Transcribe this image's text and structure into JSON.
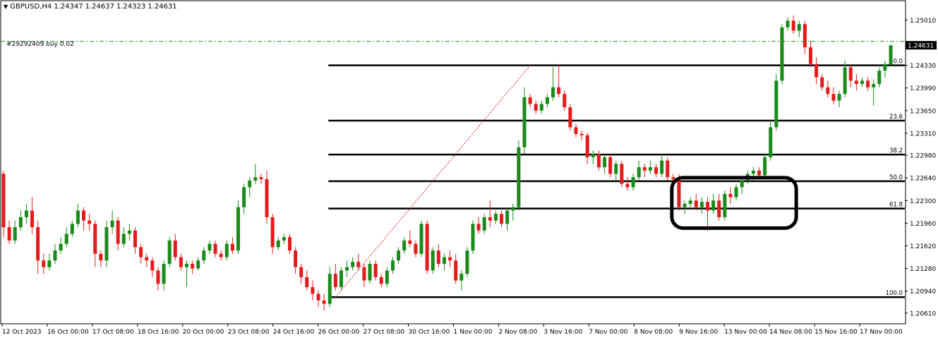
{
  "header": {
    "symbol": "GBPUSD,H4",
    "open": "1.24347",
    "high": "1.24637",
    "low": "1.24323",
    "close": "1.24631"
  },
  "order_label": "#29292409 buy 0.02",
  "current_price": "1.24631",
  "colors": {
    "bull": "#1a8a1a",
    "bear": "#e51b1b",
    "fib": "#000000",
    "order_line": "#2a8a2a",
    "trend": "#e51b1b"
  },
  "chart_data": {
    "type": "candlestick",
    "title": "GBPUSD,H4",
    "ylim": [
      1.2045,
      1.253
    ],
    "y_ticks": [
      "1.25010",
      "1.24330",
      "1.23990",
      "1.23650",
      "1.23310",
      "1.22980",
      "1.22640",
      "1.22300",
      "1.21960",
      "1.21620",
      "1.21280",
      "1.20940",
      "1.20610"
    ],
    "x_ticks": [
      "12 Oct 2023",
      "16 Oct 00:00",
      "17 Oct 08:00",
      "18 Oct 16:00",
      "20 Oct 00:00",
      "23 Oct 08:00",
      "24 Oct 16:00",
      "26 Oct 00:00",
      "27 Oct 08:00",
      "30 Oct 16:00",
      "1 Nov 00:00",
      "2 Nov 08:00",
      "3 Nov 16:00",
      "7 Nov 00:00",
      "8 Nov 08:00",
      "9 Nov 16:00",
      "13 Nov 00:00",
      "14 Nov 08:00",
      "15 Nov 16:00",
      "17 Nov 00:00"
    ],
    "fibonacci": [
      {
        "label": "0.0",
        "price": 1.2433
      },
      {
        "label": "23.6",
        "price": 1.235
      },
      {
        "label": "38.2",
        "price": 1.2299
      },
      {
        "label": "50.0",
        "price": 1.2259
      },
      {
        "label": "61.8",
        "price": 1.2218
      },
      {
        "label": "100.0",
        "price": 1.2085
      }
    ],
    "fib_anchor_bar": 57,
    "trend_line": {
      "from_bar": 58,
      "from_price": 1.2085,
      "to_bar": 92,
      "to_price": 1.2433
    },
    "order_price": 1.2469,
    "highlight_zone": {
      "from_bar": 117,
      "to_bar": 138,
      "low": 1.2195,
      "high": 1.2258
    },
    "candles": [
      [
        1.227,
        1.2275,
        1.2175,
        1.219
      ],
      [
        1.219,
        1.22,
        1.2165,
        1.217
      ],
      [
        1.217,
        1.22,
        1.2165,
        1.219
      ],
      [
        1.219,
        1.2215,
        1.2185,
        1.2205
      ],
      [
        1.2205,
        1.2225,
        1.2195,
        1.2215
      ],
      [
        1.2215,
        1.2235,
        1.218,
        1.219
      ],
      [
        1.219,
        1.22,
        1.212,
        1.214
      ],
      [
        1.214,
        1.215,
        1.212,
        1.213
      ],
      [
        1.213,
        1.215,
        1.2125,
        1.214
      ],
      [
        1.214,
        1.2165,
        1.2135,
        1.2155
      ],
      [
        1.2155,
        1.2175,
        1.215,
        1.2165
      ],
      [
        1.2165,
        1.219,
        1.216,
        1.218
      ],
      [
        1.218,
        1.22,
        1.2175,
        1.2195
      ],
      [
        1.2195,
        1.2225,
        1.219,
        1.2215
      ],
      [
        1.2215,
        1.222,
        1.2185,
        1.22
      ],
      [
        1.22,
        1.221,
        1.2185,
        1.2195
      ],
      [
        1.2195,
        1.22,
        1.213,
        1.215
      ],
      [
        1.215,
        1.2155,
        1.213,
        1.214
      ],
      [
        1.214,
        1.22,
        1.213,
        1.219
      ],
      [
        1.219,
        1.2215,
        1.218,
        1.22
      ],
      [
        1.22,
        1.2205,
        1.2155,
        1.2165
      ],
      [
        1.2165,
        1.219,
        1.216,
        1.218
      ],
      [
        1.218,
        1.2195,
        1.217,
        1.2185
      ],
      [
        1.2185,
        1.219,
        1.215,
        1.216
      ],
      [
        1.216,
        1.2165,
        1.2135,
        1.2145
      ],
      [
        1.2145,
        1.215,
        1.213,
        1.214
      ],
      [
        1.214,
        1.2145,
        1.2115,
        1.2125
      ],
      [
        1.2125,
        1.213,
        1.2095,
        1.2105
      ],
      [
        1.2105,
        1.214,
        1.2095,
        1.2135
      ],
      [
        1.2135,
        1.2175,
        1.213,
        1.217
      ],
      [
        1.217,
        1.218,
        1.214,
        1.2145
      ],
      [
        1.2145,
        1.215,
        1.2125,
        1.213
      ],
      [
        1.213,
        1.214,
        1.21,
        1.2135
      ],
      [
        1.2135,
        1.214,
        1.212,
        1.2128
      ],
      [
        1.2128,
        1.2145,
        1.2125,
        1.214
      ],
      [
        1.214,
        1.216,
        1.2135,
        1.2155
      ],
      [
        1.2155,
        1.217,
        1.215,
        1.2165
      ],
      [
        1.2165,
        1.217,
        1.2145,
        1.215
      ],
      [
        1.215,
        1.2155,
        1.214,
        1.2145
      ],
      [
        1.2145,
        1.217,
        1.214,
        1.2165
      ],
      [
        1.2165,
        1.2175,
        1.215,
        1.2155
      ],
      [
        1.2155,
        1.223,
        1.215,
        1.222
      ],
      [
        1.222,
        1.2255,
        1.221,
        1.225
      ],
      [
        1.225,
        1.2265,
        1.2235,
        1.226
      ],
      [
        1.226,
        1.2285,
        1.2255,
        1.2265
      ],
      [
        1.2265,
        1.227,
        1.2255,
        1.2262
      ],
      [
        1.2262,
        1.2275,
        1.2195,
        1.2205
      ],
      [
        1.2205,
        1.221,
        1.215,
        1.216
      ],
      [
        1.216,
        1.2175,
        1.2155,
        1.217
      ],
      [
        1.217,
        1.218,
        1.2165,
        1.2175
      ],
      [
        1.2175,
        1.218,
        1.215,
        1.2155
      ],
      [
        1.2155,
        1.216,
        1.212,
        1.213
      ],
      [
        1.213,
        1.2135,
        1.2105,
        1.2115
      ],
      [
        1.2115,
        1.2125,
        1.2095,
        1.21
      ],
      [
        1.21,
        1.211,
        1.208,
        1.209
      ],
      [
        1.209,
        1.2095,
        1.207,
        1.208
      ],
      [
        1.208,
        1.209,
        1.2065,
        1.2075
      ],
      [
        1.2075,
        1.213,
        1.207,
        1.212
      ],
      [
        1.212,
        1.2135,
        1.2095,
        1.21
      ],
      [
        1.21,
        1.213,
        1.2095,
        1.2125
      ],
      [
        1.2125,
        1.214,
        1.2115,
        1.213
      ],
      [
        1.213,
        1.2145,
        1.2125,
        1.2138
      ],
      [
        1.2138,
        1.215,
        1.2125,
        1.213
      ],
      [
        1.213,
        1.2135,
        1.21,
        1.211
      ],
      [
        1.211,
        1.214,
        1.2105,
        1.2135
      ],
      [
        1.2135,
        1.214,
        1.211,
        1.2115
      ],
      [
        1.2115,
        1.212,
        1.21,
        1.2105
      ],
      [
        1.2105,
        1.213,
        1.21,
        1.2125
      ],
      [
        1.2125,
        1.2145,
        1.212,
        1.214
      ],
      [
        1.214,
        1.216,
        1.2135,
        1.2155
      ],
      [
        1.2155,
        1.2175,
        1.215,
        1.217
      ],
      [
        1.217,
        1.2185,
        1.216,
        1.2165
      ],
      [
        1.2165,
        1.217,
        1.2145,
        1.215
      ],
      [
        1.215,
        1.22,
        1.2145,
        1.2195
      ],
      [
        1.2195,
        1.22,
        1.212,
        1.2125
      ],
      [
        1.2125,
        1.216,
        1.212,
        1.2155
      ],
      [
        1.2155,
        1.2165,
        1.213,
        1.2135
      ],
      [
        1.2135,
        1.215,
        1.2125,
        1.2145
      ],
      [
        1.2145,
        1.2155,
        1.213,
        1.214
      ],
      [
        1.214,
        1.215,
        1.2105,
        1.211
      ],
      [
        1.211,
        1.2125,
        1.2095,
        1.212
      ],
      [
        1.212,
        1.216,
        1.2115,
        1.2155
      ],
      [
        1.2155,
        1.22,
        1.215,
        1.2195
      ],
      [
        1.2195,
        1.2205,
        1.218,
        1.2185
      ],
      [
        1.2185,
        1.221,
        1.218,
        1.2205
      ],
      [
        1.2205,
        1.223,
        1.219,
        1.22
      ],
      [
        1.22,
        1.2215,
        1.2195,
        1.221
      ],
      [
        1.221,
        1.2215,
        1.219,
        1.2195
      ],
      [
        1.2195,
        1.222,
        1.2185,
        1.2215
      ],
      [
        1.2215,
        1.2225,
        1.22,
        1.222
      ],
      [
        1.222,
        1.232,
        1.2215,
        1.231
      ],
      [
        1.231,
        1.24,
        1.23,
        1.2385
      ],
      [
        1.2385,
        1.239,
        1.237,
        1.2375
      ],
      [
        1.2375,
        1.238,
        1.236,
        1.2365
      ],
      [
        1.2365,
        1.238,
        1.236,
        1.2375
      ],
      [
        1.2375,
        1.239,
        1.237,
        1.2385
      ],
      [
        1.2385,
        1.243,
        1.238,
        1.24
      ],
      [
        1.24,
        1.2435,
        1.2385,
        1.239
      ],
      [
        1.239,
        1.2395,
        1.2365,
        1.237
      ],
      [
        1.237,
        1.2375,
        1.2335,
        1.234
      ],
      [
        1.234,
        1.2345,
        1.2325,
        1.233
      ],
      [
        1.233,
        1.2335,
        1.232,
        1.2328
      ],
      [
        1.2328,
        1.2332,
        1.2285,
        1.2295
      ],
      [
        1.2295,
        1.2305,
        1.2285,
        1.23
      ],
      [
        1.23,
        1.2305,
        1.2275,
        1.228
      ],
      [
        1.228,
        1.23,
        1.227,
        1.2295
      ],
      [
        1.2295,
        1.23,
        1.2265,
        1.227
      ],
      [
        1.227,
        1.229,
        1.226,
        1.2285
      ],
      [
        1.2285,
        1.229,
        1.225,
        1.2255
      ],
      [
        1.2255,
        1.2265,
        1.2245,
        1.225
      ],
      [
        1.225,
        1.227,
        1.2245,
        1.2265
      ],
      [
        1.2265,
        1.229,
        1.226,
        1.228
      ],
      [
        1.228,
        1.2285,
        1.2265,
        1.2275
      ],
      [
        1.2275,
        1.229,
        1.227,
        1.228
      ],
      [
        1.228,
        1.2285,
        1.2265,
        1.227
      ],
      [
        1.227,
        1.23,
        1.2265,
        1.229
      ],
      [
        1.229,
        1.2295,
        1.226,
        1.2265
      ],
      [
        1.2265,
        1.227,
        1.2255,
        1.2262
      ],
      [
        1.2262,
        1.227,
        1.2215,
        1.222
      ],
      [
        1.222,
        1.223,
        1.221,
        1.2225
      ],
      [
        1.2225,
        1.2235,
        1.222,
        1.223
      ],
      [
        1.223,
        1.224,
        1.2215,
        1.222
      ],
      [
        1.222,
        1.2235,
        1.221,
        1.2228
      ],
      [
        1.2228,
        1.2235,
        1.2185,
        1.2215
      ],
      [
        1.2215,
        1.224,
        1.221,
        1.223
      ],
      [
        1.223,
        1.224,
        1.22,
        1.2205
      ],
      [
        1.2205,
        1.2245,
        1.22,
        1.224
      ],
      [
        1.224,
        1.225,
        1.2225,
        1.2235
      ],
      [
        1.2235,
        1.2255,
        1.223,
        1.225
      ],
      [
        1.225,
        1.2265,
        1.224,
        1.226
      ],
      [
        1.226,
        1.2275,
        1.2255,
        1.227
      ],
      [
        1.227,
        1.228,
        1.226,
        1.2275
      ],
      [
        1.2275,
        1.228,
        1.2262,
        1.2268
      ],
      [
        1.2268,
        1.23,
        1.2265,
        1.2295
      ],
      [
        1.2295,
        1.235,
        1.229,
        1.234
      ],
      [
        1.234,
        1.242,
        1.2335,
        1.241
      ],
      [
        1.241,
        1.2495,
        1.2405,
        1.249
      ],
      [
        1.249,
        1.2505,
        1.2485,
        1.25
      ],
      [
        1.25,
        1.2508,
        1.248,
        1.2485
      ],
      [
        1.2485,
        1.25,
        1.2475,
        1.2495
      ],
      [
        1.2495,
        1.25,
        1.245,
        1.246
      ],
      [
        1.246,
        1.247,
        1.243,
        1.2435
      ],
      [
        1.2435,
        1.2445,
        1.2405,
        1.2415
      ],
      [
        1.2415,
        1.242,
        1.2395,
        1.24
      ],
      [
        1.24,
        1.241,
        1.2385,
        1.239
      ],
      [
        1.239,
        1.24,
        1.2375,
        1.238
      ],
      [
        1.238,
        1.2395,
        1.237,
        1.239
      ],
      [
        1.239,
        1.244,
        1.2385,
        1.243
      ],
      [
        1.243,
        1.2435,
        1.24,
        1.241
      ],
      [
        1.241,
        1.242,
        1.2395,
        1.2405
      ],
      [
        1.2405,
        1.2415,
        1.24,
        1.241
      ],
      [
        1.241,
        1.2415,
        1.2395,
        1.24
      ],
      [
        1.24,
        1.2412,
        1.2372,
        1.2405
      ],
      [
        1.2405,
        1.243,
        1.24,
        1.2425
      ],
      [
        1.2425,
        1.244,
        1.2415,
        1.2435
      ],
      [
        1.2434,
        1.2464,
        1.2432,
        1.2463
      ]
    ]
  }
}
